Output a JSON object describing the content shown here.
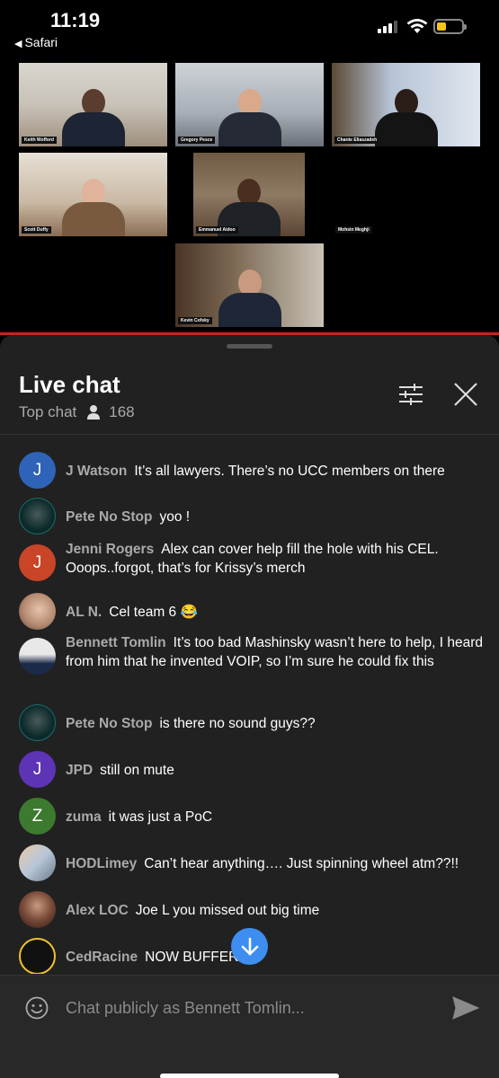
{
  "status_bar": {
    "time": "11:19",
    "back_label": "Safari"
  },
  "video": {
    "participants": [
      {
        "name": "Keith Wofford"
      },
      {
        "name": "Gregory Pesce"
      },
      {
        "name": "Chante Eliaszadeh"
      },
      {
        "name": "Scott Duffy"
      },
      {
        "name": "Emmanuel Aidoo"
      },
      {
        "name": "Mohsin Meghji"
      },
      {
        "name": "Kevin Cofsky"
      }
    ]
  },
  "chat": {
    "title": "Live chat",
    "mode": "Top chat",
    "viewer_count": "168",
    "messages": [
      {
        "author": "J Watson",
        "text": "It’s all lawyers. There’s no UCC members on there",
        "avatar_letter": "J",
        "avatar_color": "#2f63b8"
      },
      {
        "author": "Pete No Stop",
        "text": "yoo !",
        "avatar_letter": "",
        "avatar_color": "#0c2a2a"
      },
      {
        "author": "Jenni Rogers",
        "text": "Alex can cover help fill the hole with his CEL. Ooops..forgot, that’s for Krissy’s merch",
        "avatar_letter": "J",
        "avatar_color": "#c84527"
      },
      {
        "author": "AL N.",
        "text": "Cel team 6 😂",
        "avatar_letter": "",
        "avatar_color": "#c9a38a"
      },
      {
        "author": "Bennett Tomlin",
        "text": "It’s too bad Mashinsky wasn’t here to help, I heard from him that he invented VOIP, so I’m sure he could fix this",
        "avatar_letter": "",
        "avatar_color": "#d8d8d8"
      },
      {
        "author": "Pete No Stop",
        "text": "is there no sound guys??",
        "avatar_letter": "",
        "avatar_color": "#0c2a2a"
      },
      {
        "author": "JPD",
        "text": "still on mute",
        "avatar_letter": "J",
        "avatar_color": "#5d34b5"
      },
      {
        "author": "zuma",
        "text": "it was just a PoC",
        "avatar_letter": "Z",
        "avatar_color": "#3c7a2f"
      },
      {
        "author": "HODLimey",
        "text": "Can’t hear anything…. Just spinning wheel atm??!!",
        "avatar_letter": "",
        "avatar_color": "#b7c7d8"
      },
      {
        "author": "Alex LOC",
        "text": "Joe L you missed out big time",
        "avatar_letter": "",
        "avatar_color": "#4a2b22"
      },
      {
        "author": "CedRacine",
        "text": "NOW BUFFERING",
        "avatar_letter": "",
        "avatar_color": "#111111"
      }
    ]
  },
  "input": {
    "placeholder": "Chat publicly as Bennett Tomlin..."
  },
  "colors": {
    "accent": "#3d8ef0",
    "live_red": "#c3261d",
    "panel_bg": "#212121"
  }
}
